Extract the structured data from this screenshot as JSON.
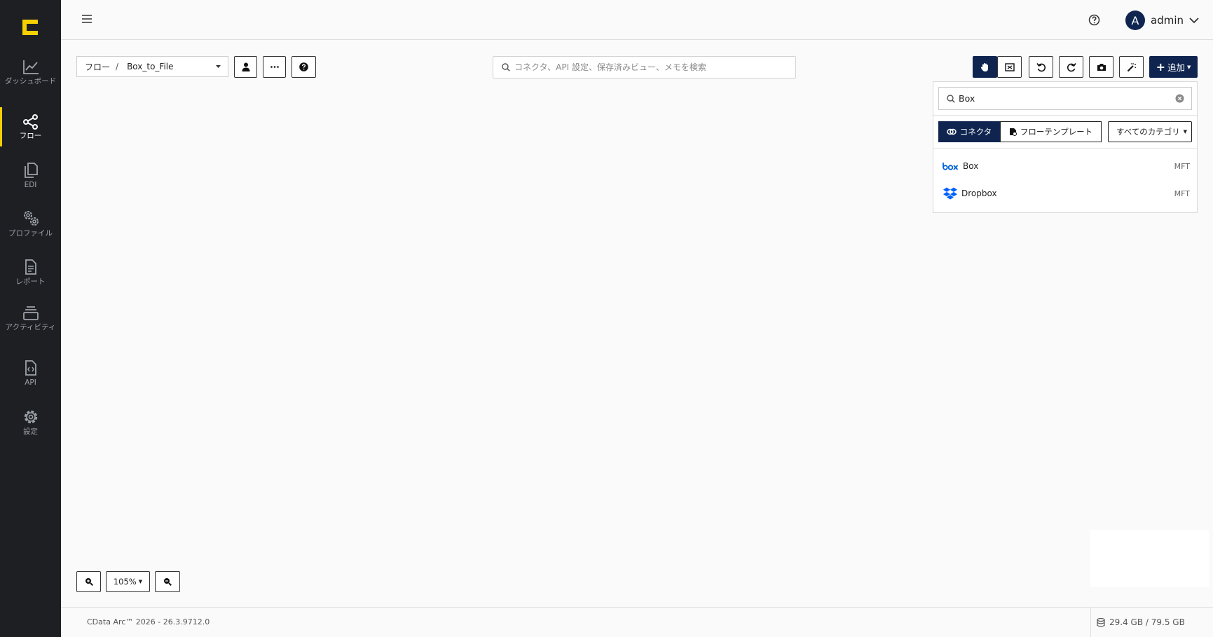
{
  "sidebar": {
    "logo": "cdata-logo-icon",
    "items": [
      {
        "label": "ダッシュボード",
        "icon": "chart-line-icon"
      },
      {
        "label": "フロー",
        "icon": "share-nodes-icon",
        "active": true
      },
      {
        "label": "EDI",
        "icon": "copy-documents-icon"
      },
      {
        "label": "プロファイル",
        "icon": "gears-icon"
      },
      {
        "label": "レポート",
        "icon": "document-lines-icon"
      },
      {
        "label": "アクティビティ",
        "icon": "layers-icon"
      },
      {
        "label": "API",
        "icon": "file-code-icon"
      },
      {
        "label": "設定",
        "icon": "gear-icon"
      }
    ]
  },
  "header": {
    "user_initial": "A",
    "username": "admin"
  },
  "toolbar": {
    "breadcrumb_root": "フロー",
    "breadcrumb_sep": "/",
    "flow_name": "Box_to_File",
    "search_placeholder": "コネクタ、API 設定、保存済みビュー、メモを検索",
    "add_label": "追加"
  },
  "panel": {
    "search_value": "Box",
    "tab_connector": "コネクタ",
    "tab_template": "フローテンプレート",
    "category": "すべてのカテゴリ",
    "results": [
      {
        "name": "Box",
        "tag": "MFT",
        "icon": "box-logo-icon"
      },
      {
        "name": "Dropbox",
        "tag": "MFT",
        "icon": "dropbox-logo-icon"
      }
    ]
  },
  "canvas": {
    "zoom": "105%"
  },
  "footer": {
    "version": "CData Arc™ 2026 - 26.3.9712.0",
    "storage": "29.4 GB / 79.5 GB"
  },
  "colors": {
    "sidebar_bg": "#1d1f23",
    "accent_yellow": "#f5d000",
    "primary_navy": "#0f2550"
  }
}
